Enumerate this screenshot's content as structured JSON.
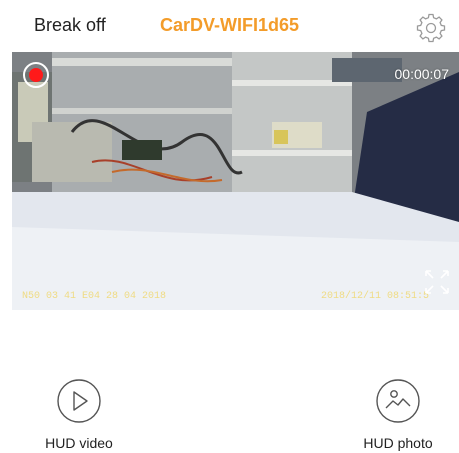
{
  "header": {
    "break_label": "Break off",
    "device_name": "CarDV-WIFI1d65",
    "settings_icon": "gear-icon",
    "title_color": "#f39c2a"
  },
  "preview": {
    "recording_indicator_color": "#ff1a1a",
    "elapsed": "00:00:07",
    "gps_overlay": "N50 03 41 E04 28 04 2018",
    "date_overlay": "2018/12/11 08:51:5",
    "fullscreen_icon": "expand-icon"
  },
  "actions": {
    "hud_video_label": "HUD video",
    "hud_video_icon": "play-icon",
    "hud_photo_label": "HUD photo",
    "hud_photo_icon": "photo-icon"
  }
}
